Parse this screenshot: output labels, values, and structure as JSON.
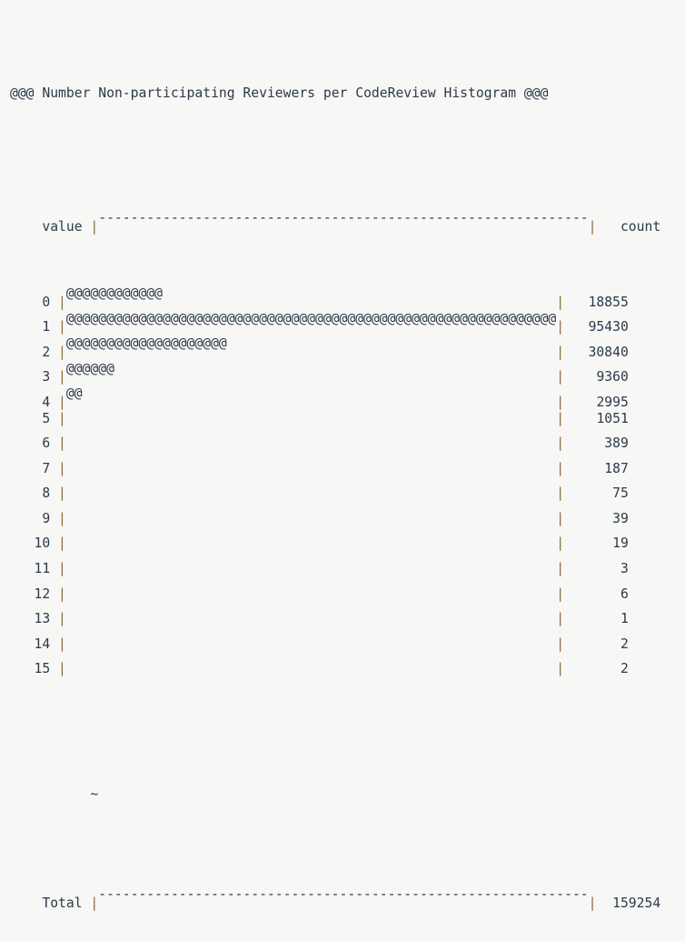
{
  "title": "@@@ Number Non-participating Reviewers per CodeReview Histogram @@@",
  "header": {
    "value_label": "value",
    "count_label": "count",
    "rule_char": "-",
    "rule_width": 61,
    "edge_char": "|"
  },
  "footer": {
    "total_label": "Total",
    "total_count": "159254",
    "continuation_marker": "~"
  },
  "colors": {
    "background": "#f7f7f5",
    "text": "#2b3a4a",
    "edge": "#8a6a3a"
  },
  "bar_char": "@",
  "rows": [
    {
      "value": "0",
      "count": "18855",
      "bar": "@@@@@@@@@@@@"
    },
    {
      "value": "1",
      "count": "95430",
      "bar": "@@@@@@@@@@@@@@@@@@@@@@@@@@@@@@@@@@@@@@@@@@@@@@@@@@@@@@@@@@@@@"
    },
    {
      "value": "2",
      "count": "30840",
      "bar": "@@@@@@@@@@@@@@@@@@@@"
    },
    {
      "value": "3",
      "count": "9360",
      "bar": "@@@@@@"
    },
    {
      "value": "4",
      "count": "2995",
      "bar": "@@"
    },
    {
      "value": "5",
      "count": "1051",
      "bar": ""
    },
    {
      "value": "6",
      "count": "389",
      "bar": ""
    },
    {
      "value": "7",
      "count": "187",
      "bar": ""
    },
    {
      "value": "8",
      "count": "75",
      "bar": ""
    },
    {
      "value": "9",
      "count": "39",
      "bar": ""
    },
    {
      "value": "10",
      "count": "19",
      "bar": ""
    },
    {
      "value": "11",
      "count": "3",
      "bar": ""
    },
    {
      "value": "12",
      "count": "6",
      "bar": ""
    },
    {
      "value": "13",
      "count": "1",
      "bar": ""
    },
    {
      "value": "14",
      "count": "2",
      "bar": ""
    },
    {
      "value": "15",
      "count": "2",
      "bar": ""
    }
  ],
  "chart_data": {
    "type": "bar",
    "title": "@@@ Number Non-participating Reviewers per CodeReview Histogram @@@",
    "xlabel": "value",
    "ylabel": "count",
    "orientation": "horizontal",
    "categories": [
      "0",
      "1",
      "2",
      "3",
      "4",
      "5",
      "6",
      "7",
      "8",
      "9",
      "10",
      "11",
      "12",
      "13",
      "14",
      "15"
    ],
    "values": [
      18855,
      95430,
      30840,
      9360,
      2995,
      1051,
      389,
      187,
      75,
      39,
      19,
      3,
      6,
      1,
      2,
      2
    ],
    "bar_lengths_chars": [
      12,
      61,
      20,
      6,
      2,
      0,
      0,
      0,
      0,
      0,
      0,
      0,
      0,
      0,
      0,
      0
    ],
    "max_bar_chars": 61,
    "total": 159254,
    "grid": false,
    "legend": null
  }
}
